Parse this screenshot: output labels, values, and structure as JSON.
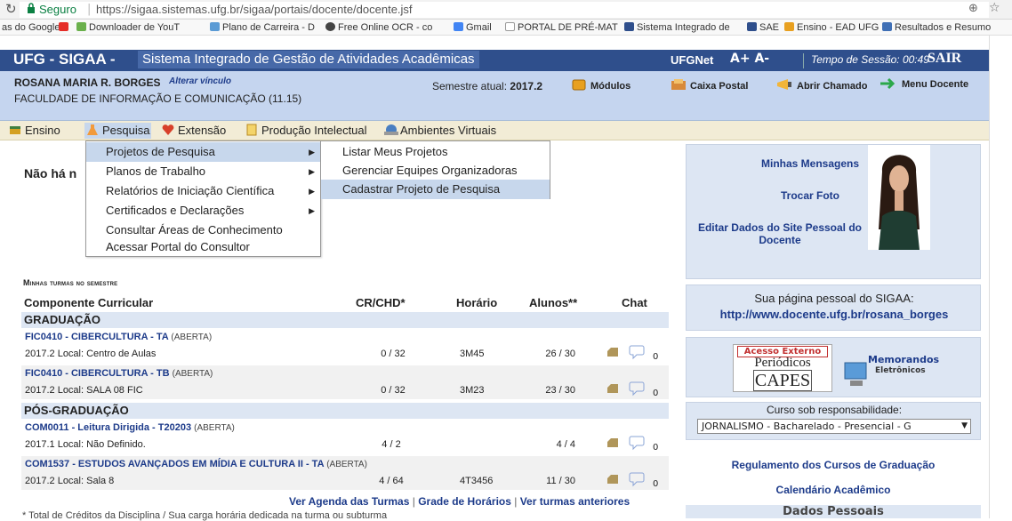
{
  "browser": {
    "secure_label": "Seguro",
    "url": "https://sigaa.sistemas.ufg.br/sigaa/portais/docente/docente.jsf"
  },
  "bookmarks": [
    {
      "label": "as do Google",
      "color": ""
    },
    {
      "label": "Downloader de YouT",
      "color": "#e52d27"
    },
    {
      "label": "Plano de Carreira - D",
      "color": "#5b9bd5"
    },
    {
      "label": "Free Online OCR - co",
      "color": "#444444"
    },
    {
      "label": "Gmail",
      "color": "#4285f4"
    },
    {
      "label": "PORTAL DE PRÉ-MAT",
      "color": "#cccccc"
    },
    {
      "label": "Sistema Integrado de",
      "color": "#2f4f8c"
    },
    {
      "label": "SAE",
      "color": "#2f4f8c"
    },
    {
      "label": "Ensino - EAD UFG",
      "color": "#e8a020"
    },
    {
      "label": "Resultados e Resumo",
      "color": "#3f6fb5"
    }
  ],
  "header": {
    "brand": "UFG - SIGAA -",
    "system": "Sistema Integrado de Gestão de Atividades Acadêmicas",
    "ufgnet": "UFGNet",
    "font_controls": "A+ A-",
    "session": "Tempo de Sessão: 00:49",
    "logout": "SAIR"
  },
  "user": {
    "name": "ROSANA MARIA R. BORGES",
    "change_link": "Alterar vínculo",
    "faculty": "FACULDADE DE INFORMAÇÃO E COMUNICAÇÃO (11.15)",
    "semester_label": "Semestre atual:",
    "semester": "2017.2"
  },
  "toolbar": {
    "modulos": "Módulos",
    "caixa": "Caixa Postal",
    "chamado": "Abrir Chamado",
    "menu": "Menu Docente"
  },
  "menubar": {
    "ensino": "Ensino",
    "pesquisa": "Pesquisa",
    "extensao": "Extensão",
    "producao": "Produção Intelectual",
    "ambientes": "Ambientes Virtuais"
  },
  "dropdown": {
    "items": [
      "Projetos de Pesquisa",
      "Planos de Trabalho",
      "Relatórios de Iniciação Científica",
      "Certificados e Declarações",
      "Consultar Áreas de Conhecimento",
      "Acessar Portal do Consultor"
    ],
    "submenu": [
      "Listar Meus Projetos",
      "Gerenciar Equipes Organizadoras",
      "Cadastrar Projeto de Pesquisa"
    ]
  },
  "notice": "Não há n",
  "turmas": {
    "heading": "Minhas turmas no semestre",
    "cols": {
      "comp": "Componente Curricular",
      "cr": "CR/CHD*",
      "horario": "Horário",
      "alunos": "Alunos**",
      "chat": "Chat"
    },
    "grad_label": "GRADUAÇÃO",
    "pos_label": "PÓS-GRADUAÇÃO",
    "rows": [
      {
        "title": "FIC0410 - CIBERCULTURA - TA",
        "status": "(ABERTA)",
        "loc": "2017.2 Local: Centro de Aulas",
        "cr": "0 / 32",
        "horario": "3M45",
        "alunos": "26 / 30",
        "chat": "0"
      },
      {
        "title": "FIC0410 - CIBERCULTURA - TB",
        "status": "(ABERTA)",
        "loc": "2017.2 Local: SALA 08 FIC",
        "cr": "0 / 32",
        "horario": "3M23",
        "alunos": "23 / 30",
        "chat": "0"
      },
      {
        "title": "COM0011 - Leitura Dirigida - T20203",
        "status": "(ABERTA)",
        "loc": "2017.1 Local: Não Definido.",
        "cr": "4 / 2",
        "horario": "",
        "alunos": "4 / 4",
        "chat": "0"
      },
      {
        "title": "COM1537 - ESTUDOS AVANÇADOS EM MÍDIA E CULTURA II - TA",
        "status": "(ABERTA)",
        "loc": "2017.2 Local: Sala 8",
        "cr": "4 / 64",
        "horario": "4T3456",
        "alunos": "11 / 30",
        "chat": "0"
      }
    ],
    "links": [
      "Ver Agenda das Turmas",
      "Grade de Horários",
      "Ver turmas anteriores"
    ],
    "footnote": "* Total de Créditos da Disciplina / Sua carga horária dedicada na turma ou subturma"
  },
  "side": {
    "mensagens": "Minhas Mensagens",
    "trocar_foto": "Trocar Foto",
    "editar": "Editar Dados do Site Pessoal do Docente",
    "pagina_label": "Sua página pessoal do SIGAA:",
    "pagina_url": "http://www.docente.ufg.br/rosana_borges",
    "capes_top": "Acesso Externo",
    "capes_mid": "Periódicos",
    "capes_bot": "CAPES",
    "memo": "Memorandos",
    "memo2": "Eletrônicos",
    "curso_label": "Curso sob responsabilidade:",
    "curso_value": "JORNALISMO - Bacharelado - Presencial - G",
    "regulamento": "Regulamento dos Cursos de Graduação",
    "calendario": "Calendário Acadêmico",
    "dados": "Dados Pessoais"
  }
}
